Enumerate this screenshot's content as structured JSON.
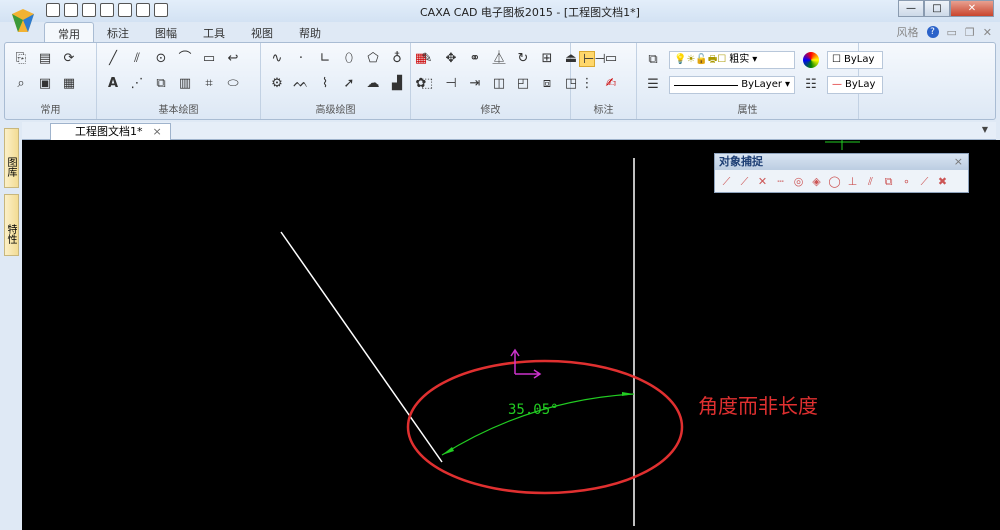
{
  "window": {
    "title": "CAXA CAD 电子图板2015 - [工程图文档1*]",
    "minimize": "—",
    "maximize": "□",
    "close": "✕"
  },
  "tabs": [
    "常用",
    "标注",
    "图幅",
    "工具",
    "视图",
    "帮助"
  ],
  "right_menu": {
    "style": "风格",
    "help": "?"
  },
  "ribbon": {
    "groups": [
      "常用",
      "基本绘图",
      "高级绘图",
      "修改",
      "标注",
      "属性"
    ],
    "properties": {
      "layer": "粗实",
      "color1": "ByLay",
      "linetype": "ByLayer",
      "color2": "ByLay"
    }
  },
  "doc_tab": {
    "label": "工程图文档1*",
    "close": "×"
  },
  "side_tabs": [
    "图库",
    "特性"
  ],
  "snap_toolbar": {
    "title": "对象捕捉",
    "close": "×"
  },
  "drawing": {
    "dimension_text": "35.05°",
    "annotation": "角度而非长度"
  },
  "colors": {
    "dimension": "#22cc22",
    "annotation": "#e03030",
    "ucs": "#cc33cc"
  }
}
